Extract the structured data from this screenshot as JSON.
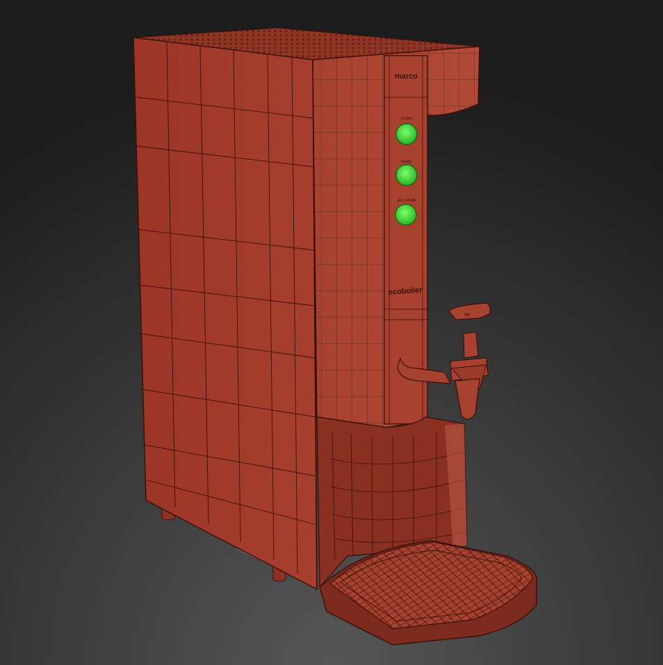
{
  "viewport": {
    "colors": {
      "background_top": "#1e1e1e",
      "background_bottom": "#4a4a4a",
      "body": "#a33d2c",
      "body_light": "#b5493a",
      "body_dark": "#7a2a1f",
      "wire": "#3a0f08",
      "button_green": "#3fd23a"
    }
  },
  "model": {
    "brand_label": "marco",
    "product_label": "ecoboiler",
    "tap_label": "tap",
    "buttons": [
      {
        "icon": "power-button-icon",
        "label": "power"
      },
      {
        "icon": "ready-button-icon",
        "label": "ready"
      },
      {
        "icon": "eco-mode-button-icon",
        "label": "eco mode"
      }
    ]
  }
}
